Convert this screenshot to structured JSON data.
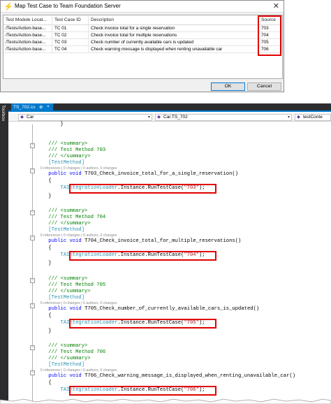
{
  "dialog": {
    "title": "Map Test Case to Team Foundation Server",
    "columns": [
      "Test Module Locat...",
      "Test Case ID",
      "Description",
      "Source"
    ],
    "rows": [
      {
        "module": "/Tests/Action-base...",
        "id": "TC 01",
        "description": "Check invoice total for a single reservation",
        "source": "703"
      },
      {
        "module": "/Tests/Action-base...",
        "id": "TC 02",
        "description": "Check invoice total for multiple reservations",
        "source": "704"
      },
      {
        "module": "/Tests/Action-base...",
        "id": "TC 03",
        "description": "Check number of currently available cars is updated",
        "source": "705"
      },
      {
        "module": "/Tests/Action-base...",
        "id": "TC 04",
        "description": "Check warning message is displayed when renting unavailable car",
        "source": "706"
      }
    ],
    "ok_label": "OK",
    "cancel_label": "Cancel"
  },
  "ide": {
    "toolbox_label": "Toolbox",
    "tab": {
      "label": "TS_702.cs",
      "pin": "⊕",
      "close": "×"
    },
    "nav": [
      "Car",
      "Car.TS_702",
      "testConte"
    ],
    "lens": "0 references | 0 changes | 0 authors, 0 changes",
    "prev_brace": "}",
    "summary_open": "/// <summary>",
    "summary_close": "/// </summary>",
    "attribute": "[TestMethod]",
    "kw_public": "public",
    "kw_void": "void",
    "open_brace": "{",
    "close_brace": "}",
    "loader_class": "TAIntegrationLoader",
    "loader_call": ".Instance.RunTestCase(",
    "loader_end": ");",
    "methods": [
      {
        "summary": "/// Test Method 703",
        "signature": "T703_Check_invoice_total_for_a_single_reservation()",
        "arg": "\"703\""
      },
      {
        "summary": "/// Test Method 704",
        "signature": "T704_Check_invoice_total_for_multiple_reservations()",
        "arg": "\"704\""
      },
      {
        "summary": "/// Test Method 705",
        "signature": "T705_Check_number_of_currently_available_cars_is_updated()",
        "arg": "\"705\""
      },
      {
        "summary": "/// Test Method 706",
        "signature": "T706_Check_warning_message_is_displayed_when_renting_unavailable_car()",
        "arg": "\"706\""
      }
    ]
  },
  "colors": {
    "highlight": "#e00000",
    "accent": "#007acc",
    "comment": "#008000",
    "keyword": "#0000ff",
    "type": "#2b91af",
    "string": "#a31515"
  }
}
